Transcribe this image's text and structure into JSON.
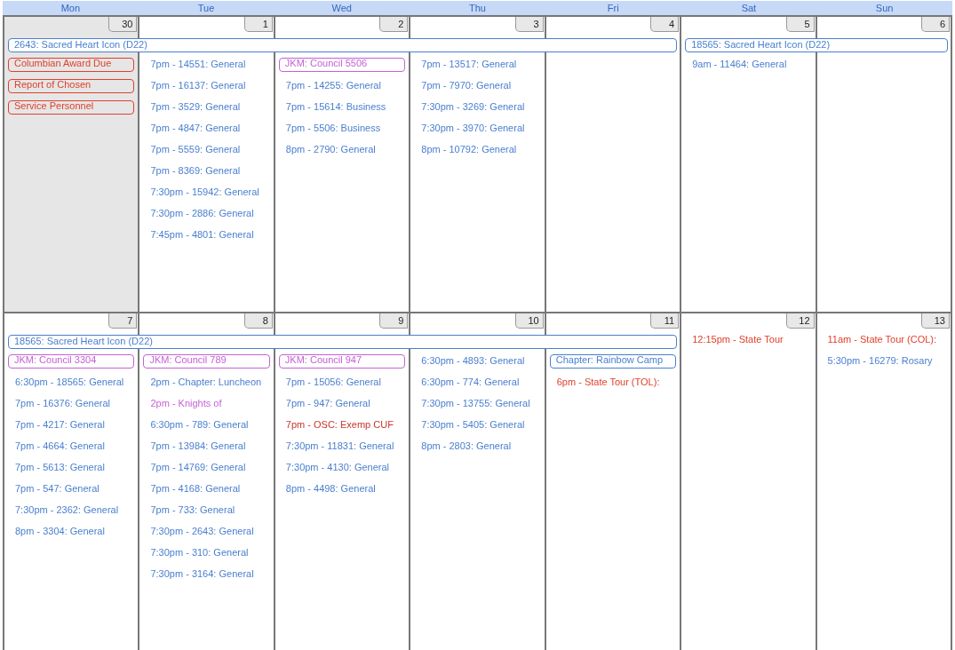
{
  "header_days": [
    "Mon",
    "Tue",
    "Wed",
    "Thu",
    "Fri",
    "Sat",
    "Sun"
  ],
  "weeks": [
    {
      "spans": [
        {
          "kind": "weekdays",
          "text": "2643: Sacred Heart Icon (D22)",
          "color": "#4a7fcf"
        },
        {
          "kind": "weekend",
          "text": "18565: Sacred Heart Icon (D22)",
          "color": "#4a7fcf"
        }
      ],
      "days": [
        {
          "date": "30",
          "other_month": true,
          "events": [
            {
              "kind": "boxed",
              "text": "Columbian Award Due",
              "color": "#e0402c"
            },
            {
              "kind": "boxed",
              "text": "Report of Chosen",
              "color": "#e0402c"
            },
            {
              "kind": "boxed",
              "text": "Service Personnel",
              "color": "#e0402c"
            }
          ]
        },
        {
          "date": "1",
          "other_month": false,
          "events": [
            {
              "kind": "timed",
              "text": "7pm - 14551: General",
              "color": "#4a7fcf"
            },
            {
              "kind": "timed",
              "text": "7pm - 16137: General",
              "color": "#4a7fcf"
            },
            {
              "kind": "timed",
              "text": "7pm - 3529: General",
              "color": "#4a7fcf"
            },
            {
              "kind": "timed",
              "text": "7pm - 4847: General",
              "color": "#4a7fcf"
            },
            {
              "kind": "timed",
              "text": "7pm - 5559: General",
              "color": "#4a7fcf"
            },
            {
              "kind": "timed",
              "text": "7pm - 8369: General",
              "color": "#4a7fcf"
            },
            {
              "kind": "timed",
              "text": "7:30pm - 15942: General",
              "color": "#4a7fcf"
            },
            {
              "kind": "timed",
              "text": "7:30pm - 2886: General",
              "color": "#4a7fcf"
            },
            {
              "kind": "timed",
              "text": "7:45pm - 4801: General",
              "color": "#4a7fcf"
            }
          ]
        },
        {
          "date": "2",
          "other_month": false,
          "events": [
            {
              "kind": "boxed",
              "text": "JKM: Council 5506",
              "color": "#c462d4"
            },
            {
              "kind": "timed",
              "text": "7pm - 14255: General",
              "color": "#4a7fcf"
            },
            {
              "kind": "timed",
              "text": "7pm - 15614: Business",
              "color": "#4a7fcf"
            },
            {
              "kind": "timed",
              "text": "7pm - 5506: Business",
              "color": "#4a7fcf"
            },
            {
              "kind": "timed",
              "text": "8pm - 2790: General",
              "color": "#4a7fcf"
            }
          ]
        },
        {
          "date": "3",
          "other_month": false,
          "events": [
            {
              "kind": "timed",
              "text": "7pm - 13517: General",
              "color": "#4a7fcf"
            },
            {
              "kind": "timed",
              "text": "7pm - 7970: General",
              "color": "#4a7fcf"
            },
            {
              "kind": "timed",
              "text": "7:30pm - 3269: General",
              "color": "#4a7fcf"
            },
            {
              "kind": "timed",
              "text": "7:30pm - 3970: General",
              "color": "#4a7fcf"
            },
            {
              "kind": "timed",
              "text": "8pm - 10792: General",
              "color": "#4a7fcf"
            }
          ]
        },
        {
          "date": "4",
          "other_month": false
        },
        {
          "date": "5",
          "other_month": false,
          "events": [
            {
              "kind": "timed",
              "text": "9am - 11464: General",
              "color": "#4a7fcf"
            }
          ]
        },
        {
          "date": "6",
          "other_month": false
        }
      ]
    },
    {
      "spans": [
        {
          "kind": "weekdays",
          "text": "18565: Sacred Heart Icon (D22)",
          "color": "#4a7fcf"
        }
      ],
      "days": [
        {
          "date": "7",
          "other_month": false,
          "events": [
            {
              "kind": "boxed",
              "text": "JKM: Council 3304",
              "color": "#c462d4"
            },
            {
              "kind": "timed",
              "text": "6:30pm - 18565: General",
              "color": "#4a7fcf"
            },
            {
              "kind": "timed",
              "text": "7pm - 16376: General",
              "color": "#4a7fcf"
            },
            {
              "kind": "timed",
              "text": "7pm - 4217: General",
              "color": "#4a7fcf"
            },
            {
              "kind": "timed",
              "text": "7pm - 4664: General",
              "color": "#4a7fcf"
            },
            {
              "kind": "timed",
              "text": "7pm - 5613: General",
              "color": "#4a7fcf"
            },
            {
              "kind": "timed",
              "text": "7pm - 547: General",
              "color": "#4a7fcf"
            },
            {
              "kind": "timed",
              "text": "7:30pm - 2362: General",
              "color": "#4a7fcf"
            },
            {
              "kind": "timed",
              "text": "8pm - 3304: General",
              "color": "#4a7fcf"
            }
          ]
        },
        {
          "date": "8",
          "other_month": false,
          "events": [
            {
              "kind": "boxed",
              "text": "JKM: Council 789",
              "color": "#c462d4"
            },
            {
              "kind": "timed",
              "text": "2pm - Chapter: Luncheon",
              "color": "#4a7fcf"
            },
            {
              "kind": "timed",
              "text": "2pm - Knights of",
              "color": "#c462d4"
            },
            {
              "kind": "timed",
              "text": "6:30pm - 789: General",
              "color": "#4a7fcf"
            },
            {
              "kind": "timed",
              "text": "7pm - 13984: General",
              "color": "#4a7fcf"
            },
            {
              "kind": "timed",
              "text": "7pm - 14769: General",
              "color": "#4a7fcf"
            },
            {
              "kind": "timed",
              "text": "7pm - 4168: General",
              "color": "#4a7fcf"
            },
            {
              "kind": "timed",
              "text": "7pm - 733: General",
              "color": "#4a7fcf"
            },
            {
              "kind": "timed",
              "text": "7:30pm - 2643: General",
              "color": "#4a7fcf"
            },
            {
              "kind": "timed",
              "text": "7:30pm - 310: General",
              "color": "#4a7fcf"
            },
            {
              "kind": "timed",
              "text": "7:30pm - 3164: General",
              "color": "#4a7fcf"
            }
          ]
        },
        {
          "date": "9",
          "other_month": false,
          "events": [
            {
              "kind": "boxed",
              "text": "JKM: Council 947",
              "color": "#c462d4"
            },
            {
              "kind": "timed",
              "text": "7pm - 15056: General",
              "color": "#4a7fcf"
            },
            {
              "kind": "timed",
              "text": "7pm - 947: General",
              "color": "#4a7fcf"
            },
            {
              "kind": "timed",
              "text": "7pm - OSC: Exemp CUF",
              "color": "#c8362c"
            },
            {
              "kind": "timed",
              "text": "7:30pm - 11831: General",
              "color": "#4a7fcf"
            },
            {
              "kind": "timed",
              "text": "7:30pm - 4130: General",
              "color": "#4a7fcf"
            },
            {
              "kind": "timed",
              "text": "8pm - 4498: General",
              "color": "#4a7fcf"
            }
          ]
        },
        {
          "date": "10",
          "other_month": false,
          "events": [
            {
              "kind": "timed",
              "text": "6:30pm - 4893: General",
              "color": "#4a7fcf"
            },
            {
              "kind": "timed",
              "text": "6:30pm - 774: General",
              "color": "#4a7fcf"
            },
            {
              "kind": "timed",
              "text": "7:30pm - 13755: General",
              "color": "#4a7fcf"
            },
            {
              "kind": "timed",
              "text": "7:30pm - 5405: General",
              "color": "#4a7fcf"
            },
            {
              "kind": "timed",
              "text": "8pm - 2803: General",
              "color": "#4a7fcf"
            }
          ]
        },
        {
          "date": "11",
          "other_month": false,
          "events": [
            {
              "kind": "boxed",
              "text": "Chapter: Rainbow Camp",
              "color": "#4a7fcf"
            },
            {
              "kind": "timed",
              "text": "6pm - State Tour (TOL):",
              "color": "#e0402c"
            }
          ]
        },
        {
          "date": "12",
          "other_month": false,
          "events": [
            {
              "kind": "timed",
              "text": "12:15pm - State Tour",
              "color": "#e0402c"
            }
          ]
        },
        {
          "date": "13",
          "other_month": false,
          "events": [
            {
              "kind": "timed",
              "text": "11am - State Tour (COL):",
              "color": "#e0402c"
            },
            {
              "kind": "timed",
              "text": "5:30pm - 16279: Rosary",
              "color": "#4a7fcf"
            }
          ]
        }
      ]
    }
  ]
}
